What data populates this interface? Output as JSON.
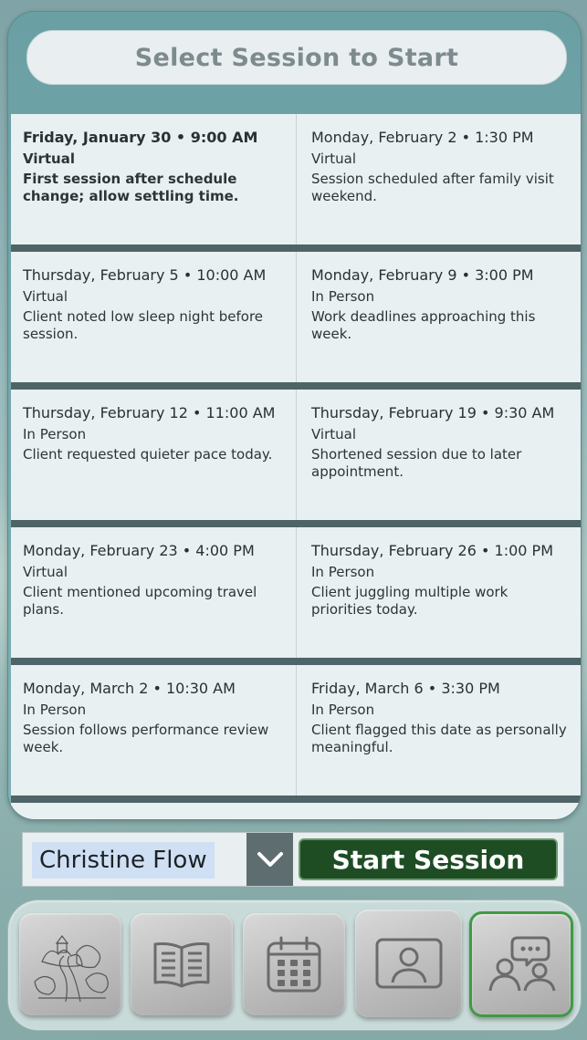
{
  "header": {
    "title": "Select Session to Start"
  },
  "sessions": [
    [
      {
        "date": "Friday, January 30 • 9:00 AM",
        "mode": "Virtual",
        "note": "First session after schedule change; allow settling time."
      },
      {
        "date": "Monday, February 2 • 1:30 PM",
        "mode": "Virtual",
        "note": "Session scheduled after family visit weekend."
      }
    ],
    [
      {
        "date": "Thursday, February 5 • 10:00 AM",
        "mode": "Virtual",
        "note": "Client noted low sleep night before session."
      },
      {
        "date": "Monday, February 9 • 3:00 PM",
        "mode": "In Person",
        "note": "Work deadlines approaching this week."
      }
    ],
    [
      {
        "date": "Thursday, February 12 • 11:00 AM",
        "mode": "In Person",
        "note": "Client requested quieter pace today."
      },
      {
        "date": "Thursday, February 19 • 9:30 AM",
        "mode": "Virtual",
        "note": "Shortened session due to later appointment."
      }
    ],
    [
      {
        "date": "Monday, February 23 • 4:00 PM",
        "mode": "Virtual",
        "note": "Client mentioned upcoming travel plans."
      },
      {
        "date": "Thursday, February 26 • 1:00 PM",
        "mode": "In Person",
        "note": "Client juggling multiple work priorities today."
      }
    ],
    [
      {
        "date": "Monday, March 2 • 10:30 AM",
        "mode": "In Person",
        "note": "Session follows performance review week."
      },
      {
        "date": "Friday, March 6 • 3:30 PM",
        "mode": "In Person",
        "note": "Client flagged this date as personally meaningful."
      }
    ]
  ],
  "selector": {
    "client_name": "Christine Flow",
    "start_label": "Start Session"
  },
  "toolbar": {
    "items": [
      {
        "icon": "landscape-path-icon"
      },
      {
        "icon": "book-icon"
      },
      {
        "icon": "calendar-icon"
      },
      {
        "icon": "contact-card-icon"
      },
      {
        "icon": "conversation-icon",
        "active": true
      }
    ]
  },
  "colors": {
    "accent_green": "#1e4d24",
    "active_border": "#3f9a45",
    "separator": "#4e6467"
  }
}
